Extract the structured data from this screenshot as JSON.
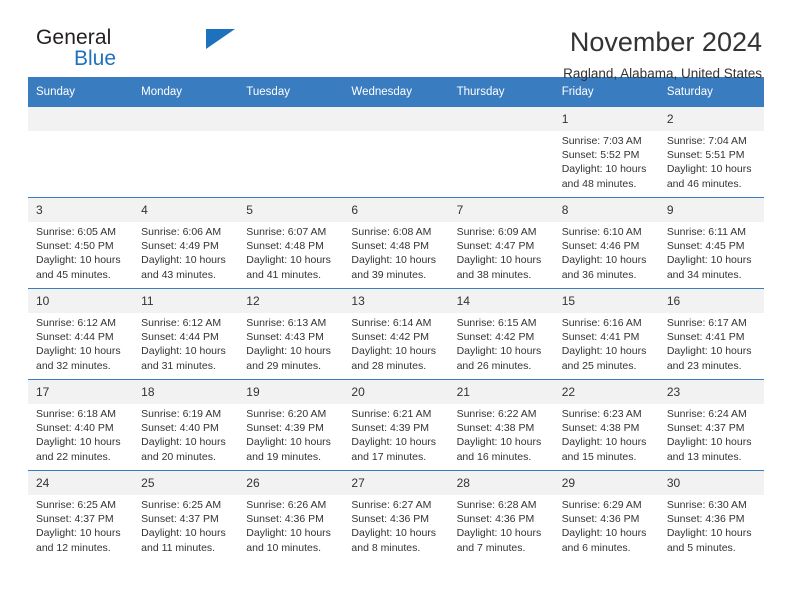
{
  "brand": {
    "name_top": "General",
    "name_bottom": "Blue",
    "accent_color": "#1e72bd"
  },
  "header": {
    "title": "November 2024",
    "subtitle": "Ragland, Alabama, United States"
  },
  "theme": {
    "header_blue": "#3a7cc0",
    "daynum_band": "#f2f2f2",
    "text": "#333333"
  },
  "weekdays": [
    "Sunday",
    "Monday",
    "Tuesday",
    "Wednesday",
    "Thursday",
    "Friday",
    "Saturday"
  ],
  "weeks": [
    [
      {
        "day": "",
        "empty": true
      },
      {
        "day": "",
        "empty": true
      },
      {
        "day": "",
        "empty": true
      },
      {
        "day": "",
        "empty": true
      },
      {
        "day": "",
        "empty": true
      },
      {
        "day": "1",
        "sunrise": "Sunrise: 7:03 AM",
        "sunset": "Sunset: 5:52 PM",
        "daylight": "Daylight: 10 hours and 48 minutes."
      },
      {
        "day": "2",
        "sunrise": "Sunrise: 7:04 AM",
        "sunset": "Sunset: 5:51 PM",
        "daylight": "Daylight: 10 hours and 46 minutes."
      }
    ],
    [
      {
        "day": "3",
        "sunrise": "Sunrise: 6:05 AM",
        "sunset": "Sunset: 4:50 PM",
        "daylight": "Daylight: 10 hours and 45 minutes."
      },
      {
        "day": "4",
        "sunrise": "Sunrise: 6:06 AM",
        "sunset": "Sunset: 4:49 PM",
        "daylight": "Daylight: 10 hours and 43 minutes."
      },
      {
        "day": "5",
        "sunrise": "Sunrise: 6:07 AM",
        "sunset": "Sunset: 4:48 PM",
        "daylight": "Daylight: 10 hours and 41 minutes."
      },
      {
        "day": "6",
        "sunrise": "Sunrise: 6:08 AM",
        "sunset": "Sunset: 4:48 PM",
        "daylight": "Daylight: 10 hours and 39 minutes."
      },
      {
        "day": "7",
        "sunrise": "Sunrise: 6:09 AM",
        "sunset": "Sunset: 4:47 PM",
        "daylight": "Daylight: 10 hours and 38 minutes."
      },
      {
        "day": "8",
        "sunrise": "Sunrise: 6:10 AM",
        "sunset": "Sunset: 4:46 PM",
        "daylight": "Daylight: 10 hours and 36 minutes."
      },
      {
        "day": "9",
        "sunrise": "Sunrise: 6:11 AM",
        "sunset": "Sunset: 4:45 PM",
        "daylight": "Daylight: 10 hours and 34 minutes."
      }
    ],
    [
      {
        "day": "10",
        "sunrise": "Sunrise: 6:12 AM",
        "sunset": "Sunset: 4:44 PM",
        "daylight": "Daylight: 10 hours and 32 minutes."
      },
      {
        "day": "11",
        "sunrise": "Sunrise: 6:12 AM",
        "sunset": "Sunset: 4:44 PM",
        "daylight": "Daylight: 10 hours and 31 minutes."
      },
      {
        "day": "12",
        "sunrise": "Sunrise: 6:13 AM",
        "sunset": "Sunset: 4:43 PM",
        "daylight": "Daylight: 10 hours and 29 minutes."
      },
      {
        "day": "13",
        "sunrise": "Sunrise: 6:14 AM",
        "sunset": "Sunset: 4:42 PM",
        "daylight": "Daylight: 10 hours and 28 minutes."
      },
      {
        "day": "14",
        "sunrise": "Sunrise: 6:15 AM",
        "sunset": "Sunset: 4:42 PM",
        "daylight": "Daylight: 10 hours and 26 minutes."
      },
      {
        "day": "15",
        "sunrise": "Sunrise: 6:16 AM",
        "sunset": "Sunset: 4:41 PM",
        "daylight": "Daylight: 10 hours and 25 minutes."
      },
      {
        "day": "16",
        "sunrise": "Sunrise: 6:17 AM",
        "sunset": "Sunset: 4:41 PM",
        "daylight": "Daylight: 10 hours and 23 minutes."
      }
    ],
    [
      {
        "day": "17",
        "sunrise": "Sunrise: 6:18 AM",
        "sunset": "Sunset: 4:40 PM",
        "daylight": "Daylight: 10 hours and 22 minutes."
      },
      {
        "day": "18",
        "sunrise": "Sunrise: 6:19 AM",
        "sunset": "Sunset: 4:40 PM",
        "daylight": "Daylight: 10 hours and 20 minutes."
      },
      {
        "day": "19",
        "sunrise": "Sunrise: 6:20 AM",
        "sunset": "Sunset: 4:39 PM",
        "daylight": "Daylight: 10 hours and 19 minutes."
      },
      {
        "day": "20",
        "sunrise": "Sunrise: 6:21 AM",
        "sunset": "Sunset: 4:39 PM",
        "daylight": "Daylight: 10 hours and 17 minutes."
      },
      {
        "day": "21",
        "sunrise": "Sunrise: 6:22 AM",
        "sunset": "Sunset: 4:38 PM",
        "daylight": "Daylight: 10 hours and 16 minutes."
      },
      {
        "day": "22",
        "sunrise": "Sunrise: 6:23 AM",
        "sunset": "Sunset: 4:38 PM",
        "daylight": "Daylight: 10 hours and 15 minutes."
      },
      {
        "day": "23",
        "sunrise": "Sunrise: 6:24 AM",
        "sunset": "Sunset: 4:37 PM",
        "daylight": "Daylight: 10 hours and 13 minutes."
      }
    ],
    [
      {
        "day": "24",
        "sunrise": "Sunrise: 6:25 AM",
        "sunset": "Sunset: 4:37 PM",
        "daylight": "Daylight: 10 hours and 12 minutes."
      },
      {
        "day": "25",
        "sunrise": "Sunrise: 6:25 AM",
        "sunset": "Sunset: 4:37 PM",
        "daylight": "Daylight: 10 hours and 11 minutes."
      },
      {
        "day": "26",
        "sunrise": "Sunrise: 6:26 AM",
        "sunset": "Sunset: 4:36 PM",
        "daylight": "Daylight: 10 hours and 10 minutes."
      },
      {
        "day": "27",
        "sunrise": "Sunrise: 6:27 AM",
        "sunset": "Sunset: 4:36 PM",
        "daylight": "Daylight: 10 hours and 8 minutes."
      },
      {
        "day": "28",
        "sunrise": "Sunrise: 6:28 AM",
        "sunset": "Sunset: 4:36 PM",
        "daylight": "Daylight: 10 hours and 7 minutes."
      },
      {
        "day": "29",
        "sunrise": "Sunrise: 6:29 AM",
        "sunset": "Sunset: 4:36 PM",
        "daylight": "Daylight: 10 hours and 6 minutes."
      },
      {
        "day": "30",
        "sunrise": "Sunrise: 6:30 AM",
        "sunset": "Sunset: 4:36 PM",
        "daylight": "Daylight: 10 hours and 5 minutes."
      }
    ]
  ]
}
